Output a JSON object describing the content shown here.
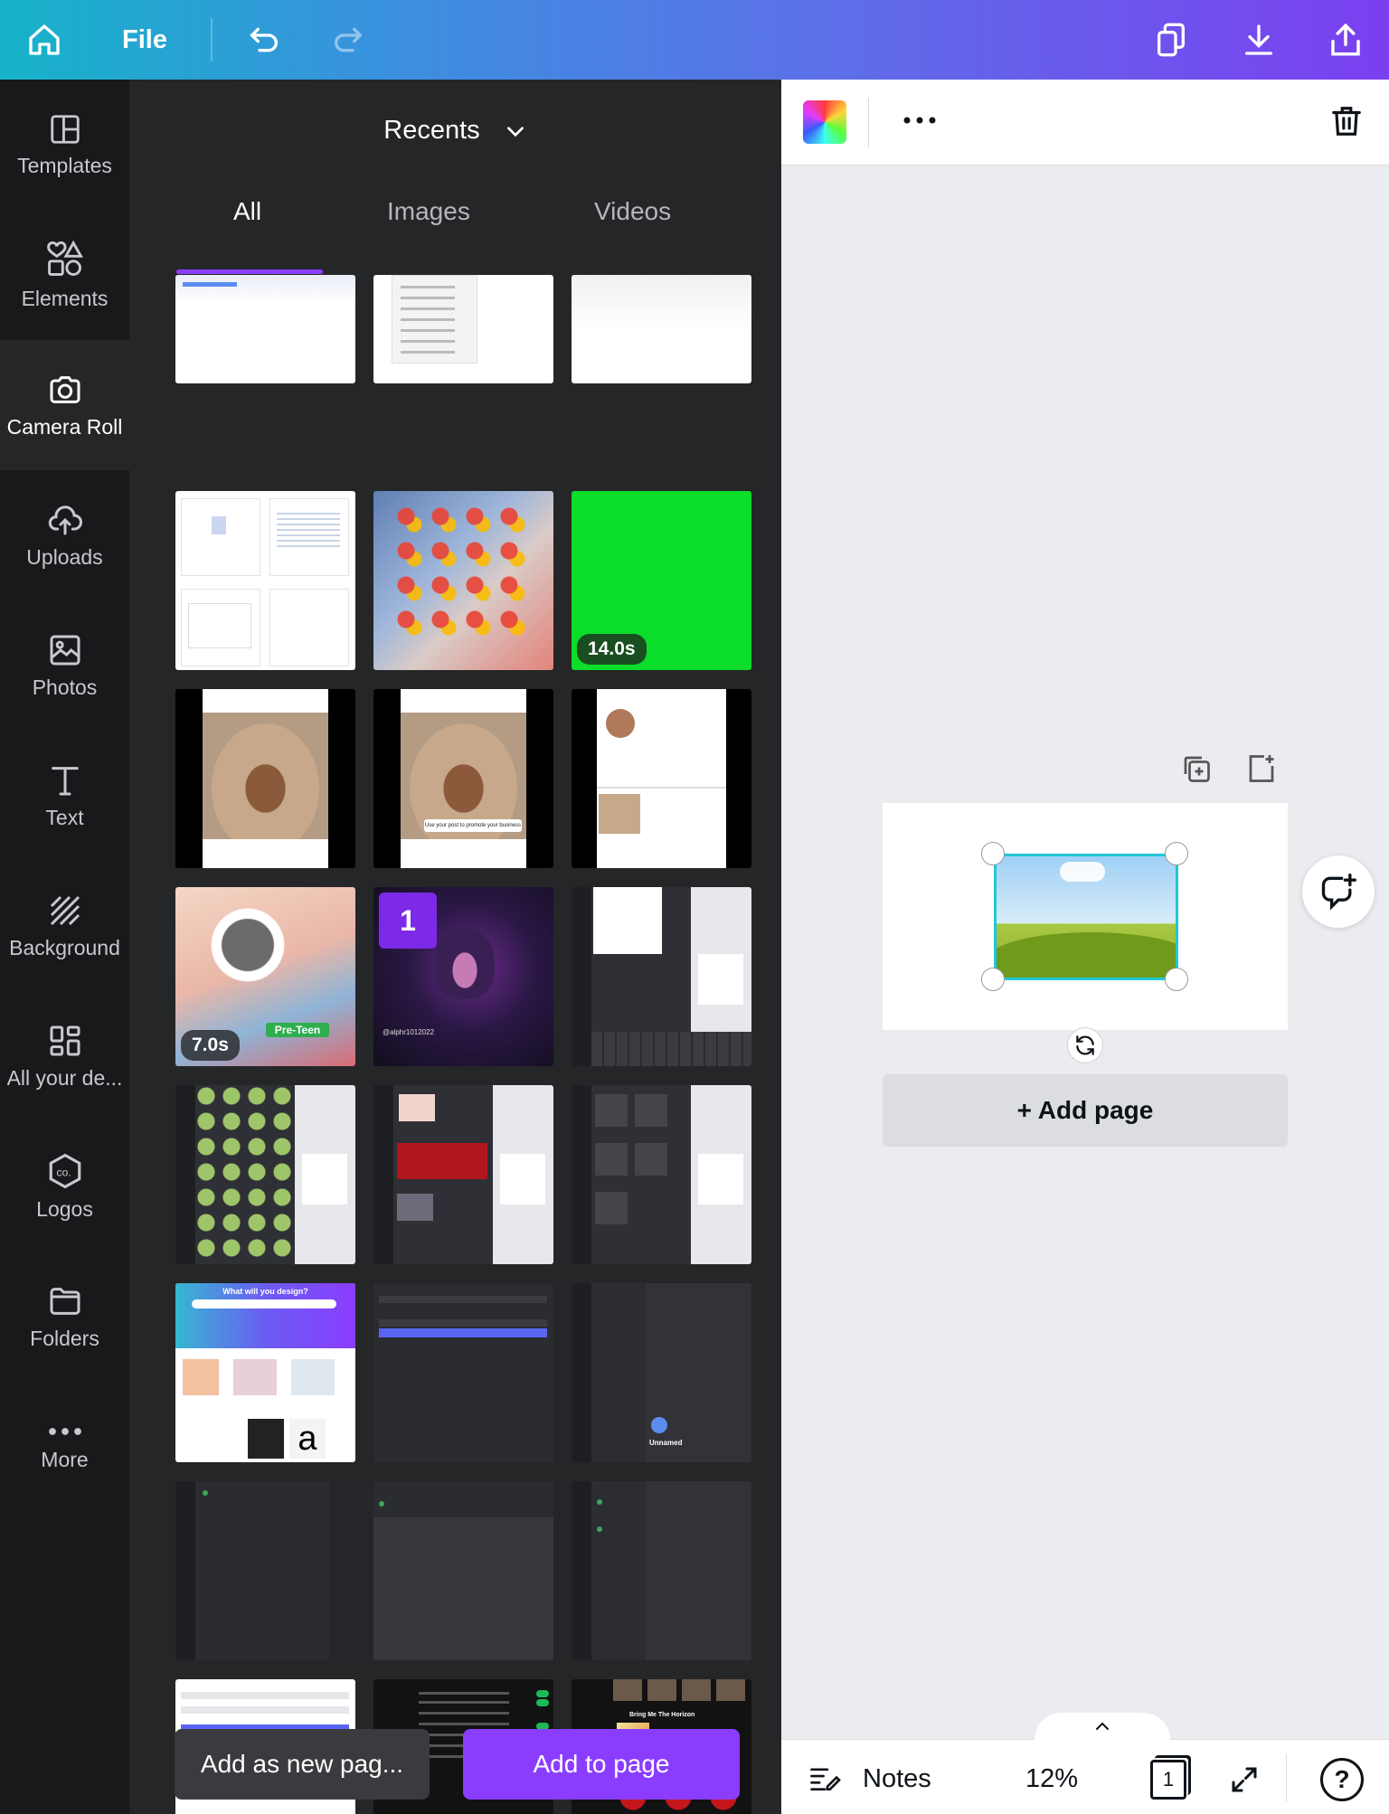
{
  "topbar": {
    "file_label": "File",
    "icons": [
      "home-icon",
      "undo-icon",
      "redo-icon",
      "copy-icon",
      "download-icon",
      "share-icon"
    ]
  },
  "rail": {
    "items": [
      {
        "label": "Templates",
        "icon": "templates-icon"
      },
      {
        "label": "Elements",
        "icon": "elements-icon"
      },
      {
        "label": "Camera Roll",
        "icon": "camera-icon"
      },
      {
        "label": "Uploads",
        "icon": "upload-cloud-icon"
      },
      {
        "label": "Photos",
        "icon": "photo-icon"
      },
      {
        "label": "Text",
        "icon": "text-icon"
      },
      {
        "label": "Background",
        "icon": "background-icon"
      },
      {
        "label": "All your de...",
        "icon": "grid-icon"
      },
      {
        "label": "Logos",
        "icon": "logo-icon"
      },
      {
        "label": "Folders",
        "icon": "folder-icon"
      },
      {
        "label": "More",
        "icon": "more-dots-icon"
      }
    ],
    "active": "Camera Roll"
  },
  "panel": {
    "dropdown_label": "Recents",
    "tabs": [
      "All",
      "Images",
      "Videos"
    ],
    "active_tab": "All",
    "thumbnails": [
      {
        "kind": "light-doc",
        "badge": ""
      },
      {
        "kind": "light-menu",
        "badge": ""
      },
      {
        "kind": "light-doc",
        "badge": ""
      },
      {
        "kind": "light-files",
        "badge": ""
      },
      {
        "kind": "phone-homescreen",
        "badge": ""
      },
      {
        "kind": "green-video",
        "badge": "14.0s"
      },
      {
        "kind": "instagram-post",
        "badge": ""
      },
      {
        "kind": "instagram-post",
        "badge": "",
        "caption": "Use your post to promote your business"
      },
      {
        "kind": "instagram-profile",
        "badge": ""
      },
      {
        "kind": "game-video",
        "badge": "7.0s",
        "tag": "Pre-Teen"
      },
      {
        "kind": "hoodie-photo",
        "badge": "",
        "selected_number": "1",
        "caption": "@alphr1012022"
      },
      {
        "kind": "canva-ui-keyboard",
        "badge": ""
      },
      {
        "kind": "canva-ui",
        "badge": ""
      },
      {
        "kind": "canva-ui-red",
        "badge": ""
      },
      {
        "kind": "canva-ui",
        "badge": ""
      },
      {
        "kind": "canva-home",
        "badge": "",
        "caption": "What will you design?"
      },
      {
        "kind": "dark-login",
        "badge": ""
      },
      {
        "kind": "discord-dm",
        "badge": "",
        "caption": "Unnamed"
      },
      {
        "kind": "discord-dark",
        "badge": ""
      },
      {
        "kind": "discord-dark",
        "badge": ""
      },
      {
        "kind": "discord-dark",
        "badge": ""
      },
      {
        "kind": "light-login",
        "badge": ""
      },
      {
        "kind": "spotify-settings",
        "badge": ""
      },
      {
        "kind": "spotify-home",
        "badge": "",
        "caption": "Bring Me The Horizon"
      }
    ],
    "add_new_page_label": "Add as new pag...",
    "add_to_page_label": "Add to page"
  },
  "editor": {
    "add_page_label": "+ Add page",
    "icons": [
      "color-swatch-icon",
      "more-options-icon",
      "trash-icon",
      "duplicate-page-icon",
      "add-page-icon",
      "rotate-icon",
      "add-comment-icon"
    ]
  },
  "footer": {
    "notes_label": "Notes",
    "zoom": "12%",
    "page_count": "1",
    "help_label": "?"
  }
}
